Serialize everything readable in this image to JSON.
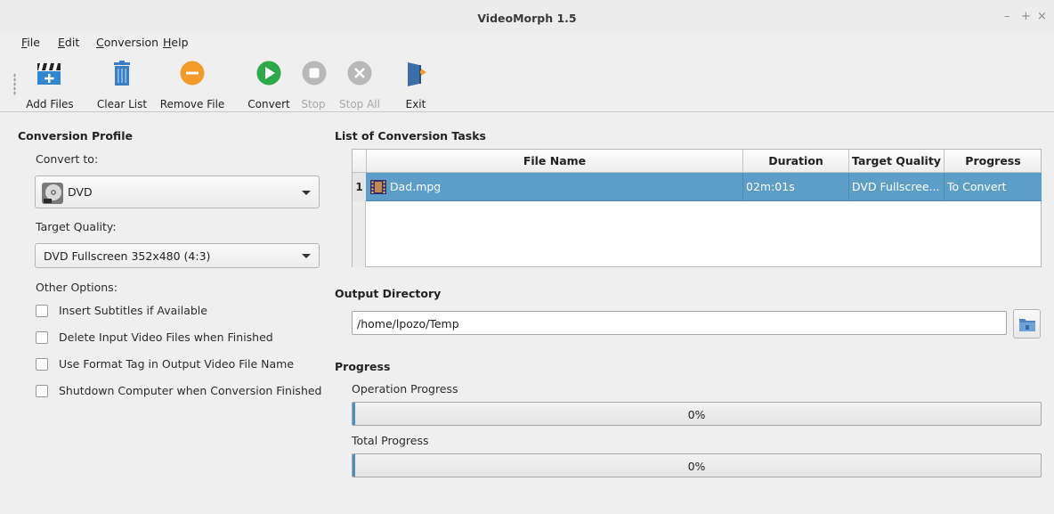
{
  "window": {
    "title": "VideoMorph 1.5",
    "controls": [
      "–",
      "+",
      "×"
    ]
  },
  "menu": {
    "items": [
      {
        "mnemonic": "F",
        "rest": "ile"
      },
      {
        "mnemonic": "E",
        "rest": "dit"
      },
      {
        "mnemonic": "C",
        "rest": "onversion"
      },
      {
        "mnemonic": "H",
        "rest": "elp"
      }
    ]
  },
  "toolbar": {
    "add_files": "Add Files",
    "clear_list": "Clear List",
    "remove_file": "Remove File",
    "convert": "Convert",
    "stop": "Stop",
    "stop_all": "Stop All",
    "exit": "Exit",
    "icons": [
      "add-video-icon",
      "trash-icon",
      "remove-icon",
      "play-icon",
      "stop-icon",
      "close-circle-icon",
      "exit-door-icon"
    ],
    "colors": {
      "remove": "#f39c2b",
      "convert": "#2ea84a",
      "trash": "#3a7fc4",
      "disabled": "#b8b8b8"
    }
  },
  "profile": {
    "title": "Conversion Profile",
    "convert_to_label": "Convert to:",
    "convert_to_value": "DVD",
    "target_quality_label": "Target Quality:",
    "target_quality_value": "DVD Fullscreen 352x480 (4:3)",
    "other_options_label": "Other Options:",
    "options": [
      {
        "label": "Insert Subtitles if Available",
        "checked": false
      },
      {
        "label": "Delete Input Video Files when Finished",
        "checked": false
      },
      {
        "label": "Use Format Tag in Output Video File Name",
        "checked": false
      },
      {
        "label": "Shutdown Computer when Conversion Finished",
        "checked": false
      }
    ]
  },
  "tasks": {
    "title": "List of Conversion Tasks",
    "columns": [
      "File Name",
      "Duration",
      "Target Quality",
      "Progress"
    ],
    "rows": [
      {
        "num": "1",
        "file": "Dad.mpg",
        "duration": "02m:01s",
        "quality": "DVD Fullscree...",
        "progress": "To Convert"
      }
    ],
    "selected_color": "#5c9ec8"
  },
  "output": {
    "title": "Output Directory",
    "path": "/home/lpozo/Temp"
  },
  "progress": {
    "title": "Progress",
    "operation_label": "Operation Progress",
    "operation_value": "0%",
    "operation_fraction": 0,
    "total_label": "Total Progress",
    "total_value": "0%",
    "total_fraction": 0
  }
}
